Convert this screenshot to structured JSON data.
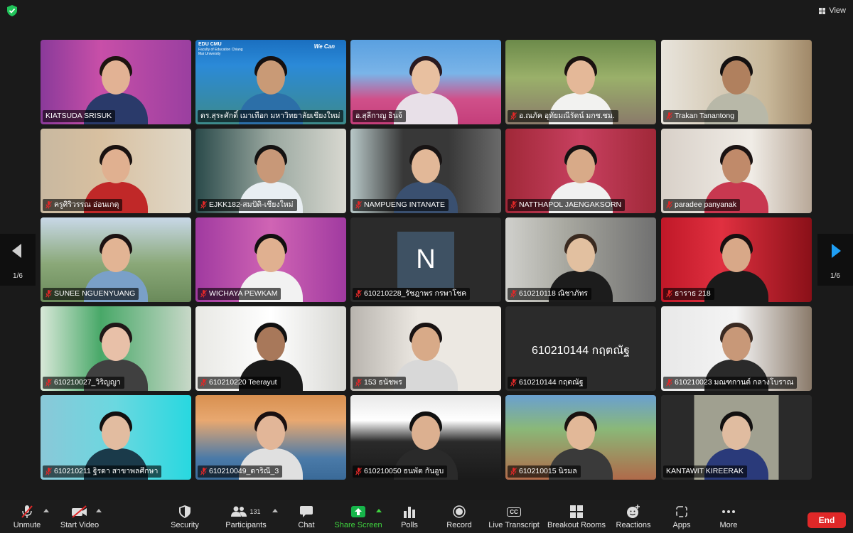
{
  "top": {
    "view_label": "View"
  },
  "nav": {
    "page_left": "1/6",
    "page_right": "1/6"
  },
  "participants": [
    {
      "name": "KIATSUDA SRISUK",
      "muted": false
    },
    {
      "name": "ดร.สุระศักดิ์ เมาเทือก มหาวิทยาลัยเชียงใหม่",
      "muted": false,
      "active": true,
      "banner_left": "EDU CMU",
      "banner_sub": "Faculty of Education Chiang Mai University",
      "banner_right": "We Can"
    },
    {
      "name": "อ.สุลีกาญ ธินจ้",
      "muted": false
    },
    {
      "name": "อ.ณภัค อุทัยมณีรัตน์ มกช.ชม.",
      "muted": true
    },
    {
      "name": "Trakan Tanantong",
      "muted": true
    },
    {
      "name": "ครูศิริวรรณ อ่อนเกตุ",
      "muted": true
    },
    {
      "name": "EJKK182-สมปัติ-เชียงใหม่",
      "muted": true
    },
    {
      "name": "NAMPUENG INTANATE",
      "muted": true
    },
    {
      "name": "NATTHAPOL JAENGAKSORN",
      "muted": true
    },
    {
      "name": "paradee panyanak",
      "muted": true
    },
    {
      "name": "SUNEE NGUENYUANG",
      "muted": true
    },
    {
      "name": "WICHAYA PEWKAM",
      "muted": true
    },
    {
      "name": "610210228_รัชฎาพร กรพาโชค",
      "muted": true,
      "avatar_letter": "N"
    },
    {
      "name": "610210118 ณิชาภัทร",
      "muted": true
    },
    {
      "name": "ธาราธ 218",
      "muted": true
    },
    {
      "name": "610210027_วิริญญา",
      "muted": true
    },
    {
      "name": "610210220 Teerayut",
      "muted": true
    },
    {
      "name": "153 ธนัชพร",
      "muted": true
    },
    {
      "name": "610210144 กฤตณัฐ",
      "muted": true,
      "center_name": "610210144 กฤตณัฐ"
    },
    {
      "name": "610210023 มณฑกานต์ กลางโบราณ",
      "muted": true
    },
    {
      "name": "610210211 ฐิรดา สาขาพลศึกษา",
      "muted": true
    },
    {
      "name": "610210049_ดาริณี_3",
      "muted": true
    },
    {
      "name": "610210050 ธนพัต กันอูบ",
      "muted": true
    },
    {
      "name": "610210015 นิรมล",
      "muted": true
    },
    {
      "name": "KANTAWIT KIREERAK",
      "muted": false
    }
  ],
  "toolbar": {
    "unmute": "Unmute",
    "start_video": "Start Video",
    "security": "Security",
    "participants": "Participants",
    "participants_count": "131",
    "chat": "Chat",
    "share_screen": "Share Screen",
    "polls": "Polls",
    "record": "Record",
    "live_transcript": "Live Transcript",
    "cc": "CC",
    "breakout_rooms": "Breakout Rooms",
    "reactions": "Reactions",
    "apps": "Apps",
    "more": "More",
    "end": "End"
  },
  "colors": {
    "active_speaker": "#3fd43f",
    "end_button": "#e02828",
    "muted_mic": "#e02828",
    "accent_arrow": "#1f9ff5"
  }
}
